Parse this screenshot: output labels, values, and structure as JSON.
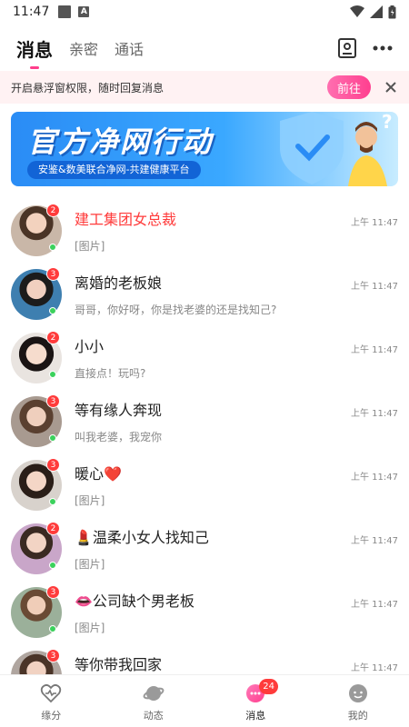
{
  "status_bar": {
    "time": "11:47",
    "app_icon_a": "A"
  },
  "header": {
    "tabs": [
      {
        "label": "消息",
        "active": true
      },
      {
        "label": "亲密",
        "active": false
      },
      {
        "label": "通话",
        "active": false
      }
    ],
    "icons": [
      "contact-card-icon",
      "more-icon"
    ]
  },
  "notice": {
    "text": "开启悬浮窗权限，随时回复消息",
    "action_label": "前往"
  },
  "banner": {
    "title": "官方净网行动",
    "subtitle": "安鉴&数美联合净网-共建健康平台"
  },
  "conversations": [
    {
      "name": "建工集团女总裁",
      "message": "[图片]",
      "time": "上午 11:47",
      "unread": "2",
      "highlight": true
    },
    {
      "name": "离婚的老板娘",
      "message": "哥哥，你好呀，你是找老婆的还是找知己?",
      "time": "上午 11:47",
      "unread": "3",
      "highlight": false
    },
    {
      "name": "小小",
      "message": "直接点！玩吗?",
      "time": "上午 11:47",
      "unread": "2",
      "highlight": false
    },
    {
      "name": "等有缘人奔现",
      "message": "叫我老婆，我宠你",
      "time": "上午 11:47",
      "unread": "3",
      "highlight": false
    },
    {
      "name": "暖心❤️",
      "message": "[图片]",
      "time": "上午 11:47",
      "unread": "3",
      "highlight": false
    },
    {
      "name": "💄温柔小女人找知己",
      "message": "[图片]",
      "time": "上午 11:47",
      "unread": "2",
      "highlight": false
    },
    {
      "name": "👄公司缺个男老板",
      "message": "[图片]",
      "time": "上午 11:47",
      "unread": "3",
      "highlight": false
    },
    {
      "name": "等你带我回家",
      "message": "",
      "time": "上午 11:47",
      "unread": "3",
      "highlight": false
    }
  ],
  "bottom_nav": {
    "items": [
      {
        "label": "缘分",
        "icon": "heart-pulse-icon"
      },
      {
        "label": "动态",
        "icon": "planet-icon"
      },
      {
        "label": "消息",
        "icon": "message-bubble-icon",
        "badge": "24",
        "active": true
      },
      {
        "label": "我的",
        "icon": "profile-face-icon"
      }
    ]
  },
  "colors": {
    "accent": "#ff3d8b",
    "badge": "#ff3b3b",
    "online": "#3bd15c",
    "banner_blue": "#2a8cf5"
  }
}
